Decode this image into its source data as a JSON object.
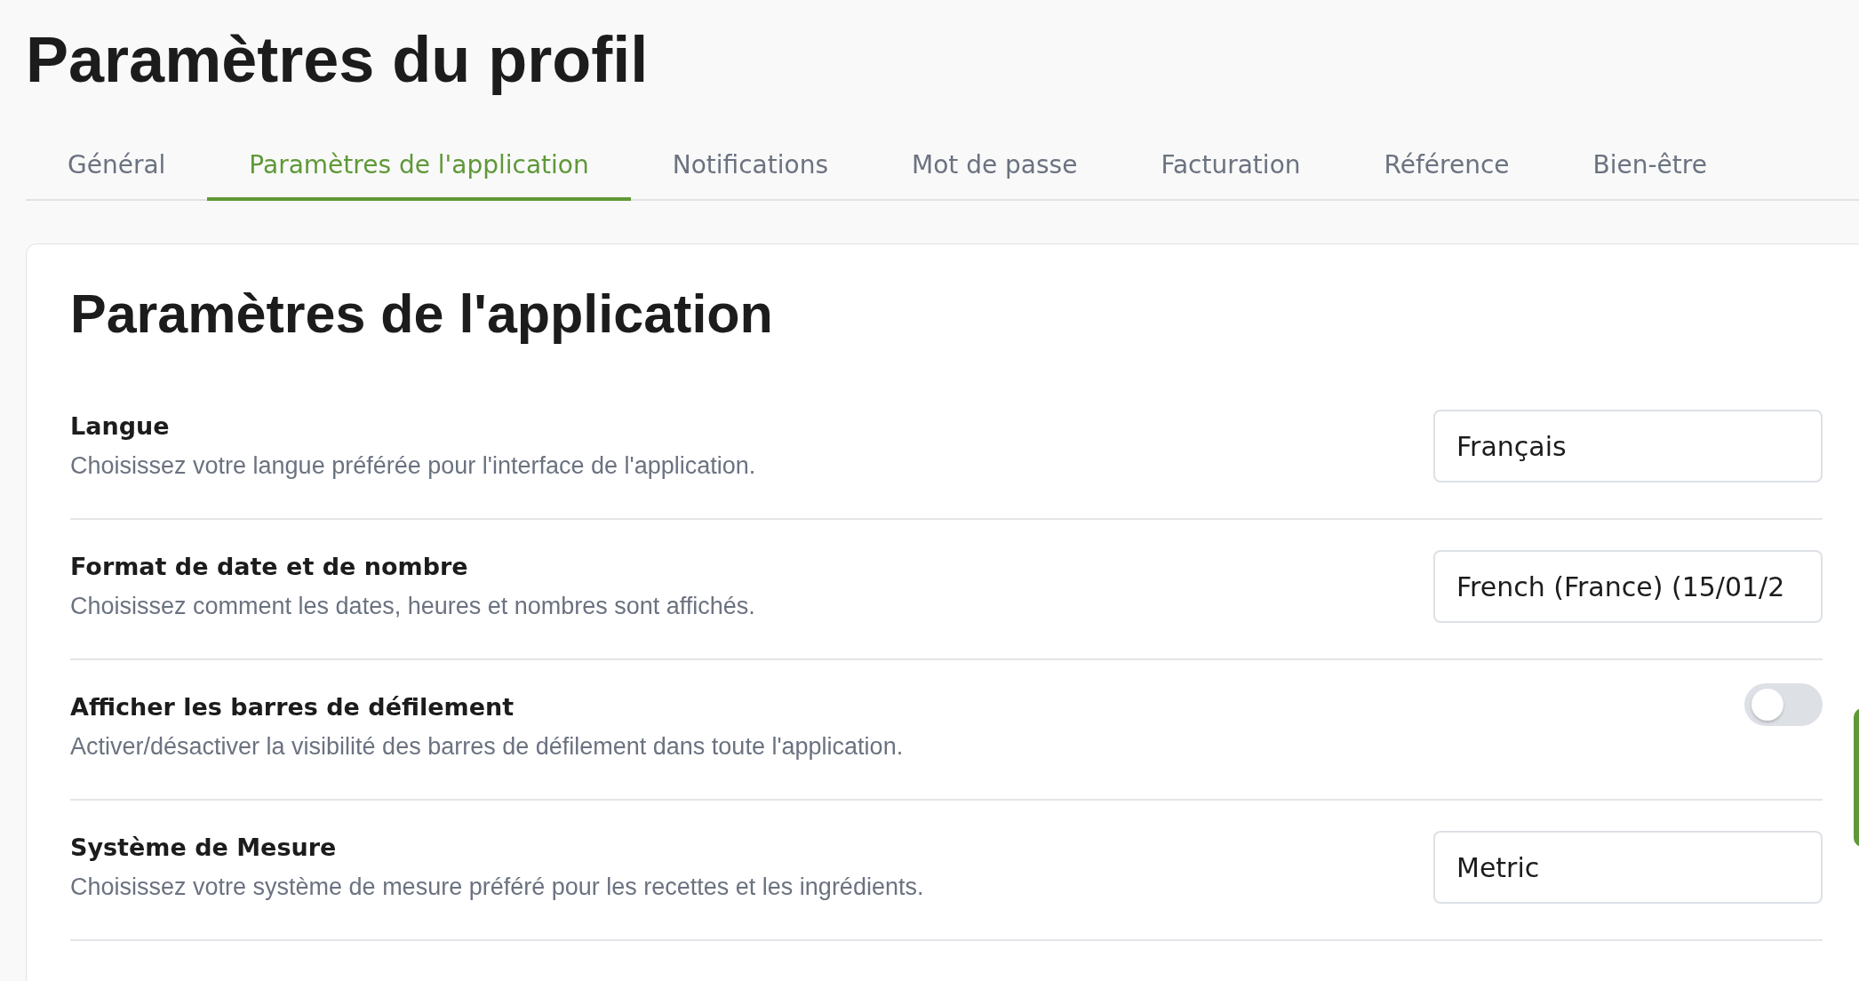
{
  "page_title": "Paramètres du profil",
  "tabs": [
    {
      "label": "Général",
      "selected": false
    },
    {
      "label": "Paramètres de l'application",
      "selected": true
    },
    {
      "label": "Notifications",
      "selected": false
    },
    {
      "label": "Mot de passe",
      "selected": false
    },
    {
      "label": "Facturation",
      "selected": false
    },
    {
      "label": "Référence",
      "selected": false
    },
    {
      "label": "Bien-être",
      "selected": false
    }
  ],
  "card": {
    "title": "Paramètres de l'application",
    "settings": [
      {
        "kind": "select",
        "label": "Langue",
        "description": "Choisissez votre langue préférée pour l'interface de l'application.",
        "value": "Français"
      },
      {
        "kind": "select",
        "label": "Format de date et de nombre",
        "description": "Choisissez comment les dates, heures et nombres sont affichés.",
        "value": "French (France) (15/01/2"
      },
      {
        "kind": "toggle",
        "label": "Afficher les barres de défilement",
        "description": "Activer/désactiver la visibilité des barres de défilement dans toute l'application.",
        "on": false
      },
      {
        "kind": "select",
        "label": "Système de Mesure",
        "description": "Choisissez votre système de mesure préféré pour les recettes et les ingrédients.",
        "value": "Metric"
      }
    ]
  }
}
